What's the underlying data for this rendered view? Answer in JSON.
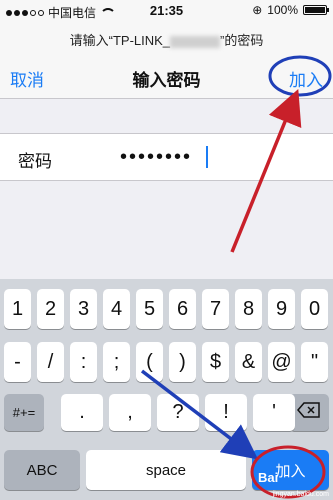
{
  "status_bar": {
    "carrier": "中国电信",
    "time": "21:35",
    "battery": "100%",
    "battery_level": 1.0,
    "signal_bars_filled": 3,
    "signal_bars_total": 5
  },
  "navbar": {
    "prompt_prefix": "请输入“TP-LINK_",
    "prompt_suffix": "”的密码",
    "cancel": "取消",
    "title": "输入密码",
    "join": "加入"
  },
  "password_field": {
    "label": "密码",
    "value": "••••••••"
  },
  "keyboard": {
    "row1": [
      "1",
      "2",
      "3",
      "4",
      "5",
      "6",
      "7",
      "8",
      "9",
      "0"
    ],
    "row2": [
      "-",
      "/",
      ":",
      ";",
      "(",
      ")",
      "$",
      "&",
      "@",
      "\""
    ],
    "row3_toggle": "#+=",
    "row3": [
      ".",
      ",",
      "?",
      "!",
      "'"
    ],
    "delete_icon": "backspace-icon",
    "abc": "ABC",
    "space": "space",
    "return": "加入"
  },
  "watermark": {
    "logo": "Bai",
    "text": "jingyan.baidu.com"
  },
  "colors": {
    "accent": "#1a7cf5",
    "annotation_red": "#c8202a",
    "annotation_blue": "#1f3fb7"
  }
}
